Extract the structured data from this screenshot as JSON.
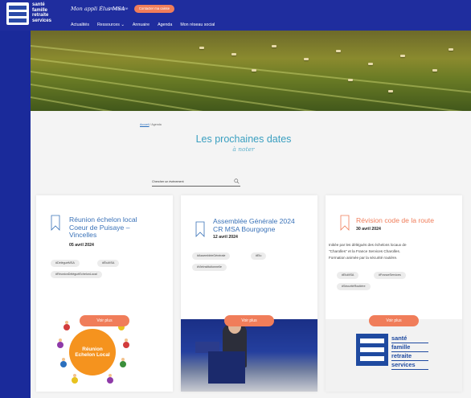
{
  "header": {
    "logo_lines": [
      "santé",
      "famille",
      "retraite",
      "services"
    ],
    "tagline": "Mon appli Élus MSA",
    "tagline_region": "| Bourgogne",
    "cta_label": "Contacter ma caisse",
    "nav": [
      "Actualités",
      "Ressources ⌄",
      "Annuaire",
      "Agenda",
      "Mon réseau social"
    ]
  },
  "breadcrumb": {
    "home": "Accueil",
    "current": "/ Agenda"
  },
  "page": {
    "title": "Les prochaines dates",
    "subtitle": "à noter"
  },
  "search": {
    "placeholder": "Chercher un événement"
  },
  "cards": [
    {
      "title_lines": [
        "Réunion échelon local",
        "Coeur de Puisaye –",
        "Vincelles"
      ],
      "date": "05 avril 2024",
      "tags": [
        "#DéléguéMSA",
        "#ÉluMSA",
        "#RéunionDéléguéEchelonLocal"
      ],
      "button": "Voir plus",
      "image_text": [
        "Réunion",
        "Echelon Local"
      ]
    },
    {
      "title_lines": [
        "Assemblée Générale 2024",
        "CR MSA Bourgogne"
      ],
      "date": "12 avril 2024",
      "tags": [
        "#AssembléeGénérale",
        "#Elu",
        "#VieInstitutionnelle"
      ],
      "button": "Voir plus"
    },
    {
      "title_lines": [
        "Révision code de la route"
      ],
      "date": "30 avril 2024",
      "description_lines": [
        "Initiée par les délégués des échelons locaux de",
        "\"Charolles\" et la France Services Charolles.",
        "Formation animée par la sécurité routière."
      ],
      "tags": [
        "#EluMSA",
        "#FranceServices",
        "#SécuritéRoutière"
      ],
      "button": "Voir plus",
      "image_words": [
        "santé",
        "famille",
        "retraite",
        "services"
      ]
    }
  ],
  "colors": {
    "brand_blue": "#1f2d9e",
    "accent_orange": "#f07d5a",
    "title_blue": "#3a72b8",
    "heading_teal": "#3a9fc0"
  }
}
